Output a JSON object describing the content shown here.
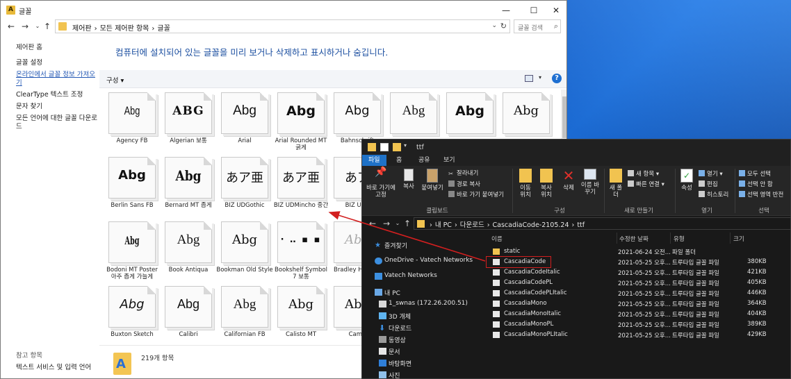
{
  "font_window": {
    "title": "글꼴",
    "breadcrumbs": [
      "제어판",
      "›",
      "모든 제어판 항목",
      "›",
      "글꼴"
    ],
    "search_placeholder": "글꼴 검색",
    "sidebar": {
      "home": "제어판 홈",
      "links": [
        "글꼴 설정",
        "온라인에서 글꼴 정보 가져오기",
        "ClearType 텍스트 조정",
        "문자 찾기",
        "모든 언어에 대한 글꼴 다운로드"
      ],
      "see_also_title": "참고 항목",
      "see_also_item": "텍스트 서비스 및 입력 언어"
    },
    "heading": "컴퓨터에 설치되어 있는 글꼴을 미리 보거나 삭제하고 표시하거나 숨깁니다.",
    "organize": "구성 ▾",
    "fonts": [
      {
        "sample": "Abg",
        "name": "Agency FB"
      },
      {
        "sample": "ABG",
        "name": "Algerian 보통"
      },
      {
        "sample": "Abg",
        "name": "Arial"
      },
      {
        "sample": "Abg",
        "name": "Arial Rounded MT 굵게"
      },
      {
        "sample": "Abg",
        "name": "Bahnschrift"
      },
      {
        "sample": "Abg",
        "name": ""
      },
      {
        "sample": "Abg",
        "name": ""
      },
      {
        "sample": "Abg",
        "name": ""
      },
      {
        "sample": "Abg",
        "name": "Berlin Sans FB"
      },
      {
        "sample": "Abg",
        "name": "Bernard MT 좁게"
      },
      {
        "sample": "あア亜",
        "name": "BIZ UDGothic"
      },
      {
        "sample": "あア亜",
        "name": "BIZ UDMincho 중간"
      },
      {
        "sample": "あア",
        "name": "BIZ UDP"
      },
      {
        "sample": "Abg",
        "name": "Bodoni MT Poster 아주 좁게 가늘게"
      },
      {
        "sample": "Abg",
        "name": "Book Antiqua"
      },
      {
        "sample": "Abg",
        "name": "Bookman Old Style"
      },
      {
        "sample": "· ‥ ▪ ▪",
        "name": "Bookshelf Symbol 7 보통"
      },
      {
        "sample": "Abg",
        "name": "Bradley H ITC 보"
      },
      {
        "sample": "Abg",
        "name": "Buxton Sketch"
      },
      {
        "sample": "Abg",
        "name": "Calibri"
      },
      {
        "sample": "Abg",
        "name": "Californian FB"
      },
      {
        "sample": "Abg",
        "name": "Calisto MT"
      },
      {
        "sample": "Abg",
        "name": "Camb"
      }
    ],
    "status_count": "219개 항목"
  },
  "explorer": {
    "title": "ttf",
    "tabs": [
      "파일",
      "홈",
      "공유",
      "보기"
    ],
    "ribbon": {
      "pin": "바로 가기에 고정",
      "copy": "복사",
      "paste": "붙여넣기",
      "cut": "잘라내기",
      "copy_path": "경로 복사",
      "paste_shortcut": "바로 가기 붙여넣기",
      "move_to": "이동 위치",
      "copy_to": "복사 위치",
      "delete": "삭제",
      "rename": "이름 바꾸기",
      "new_folder": "새 폴더",
      "new_item": "새 항목 ▾",
      "easy_access": "빠른 연결 ▾",
      "properties": "속성",
      "open": "열기 ▾",
      "edit": "편집",
      "history": "히스토리",
      "select_all": "모두 선택",
      "select_none": "선택 안 함",
      "invert_selection": "선택 영역 반전",
      "group_clipboard": "클립보드",
      "group_organize": "구성",
      "group_new": "새로 만들기",
      "group_open": "열기",
      "group_select": "선택"
    },
    "breadcrumbs": [
      "내 PC",
      "›",
      "다운로드",
      "›",
      "CascadiaCode-2105.24",
      "›",
      "ttf"
    ],
    "nav": [
      "즐겨찾기",
      "OneDrive - Vatech Networks",
      "Vatech Networks",
      "내 PC",
      "1_swnas (172.26.200.51)",
      "3D 개체",
      "다운로드",
      "동영상",
      "문서",
      "바탕화면",
      "사진"
    ],
    "columns": [
      "이름",
      "수정한 날짜",
      "유형",
      "크기"
    ],
    "files": [
      {
        "name": "static",
        "date": "2021-06-24 오전...",
        "type": "파일 폴더",
        "size": ""
      },
      {
        "name": "CascadiaCode",
        "date": "2021-05-25 오후...",
        "type": "트루타입 글꼴 파일",
        "size": "380KB"
      },
      {
        "name": "CascadiaCodeItalic",
        "date": "2021-05-25 오후...",
        "type": "트루타입 글꼴 파일",
        "size": "421KB"
      },
      {
        "name": "CascadiaCodePL",
        "date": "2021-05-25 오후...",
        "type": "트루타입 글꼴 파일",
        "size": "405KB"
      },
      {
        "name": "CascadiaCodePLItalic",
        "date": "2021-05-25 오후...",
        "type": "트루타입 글꼴 파일",
        "size": "446KB"
      },
      {
        "name": "CascadiaMono",
        "date": "2021-05-25 오후...",
        "type": "트루타입 글꼴 파일",
        "size": "364KB"
      },
      {
        "name": "CascadiaMonoItalic",
        "date": "2021-05-25 오후...",
        "type": "트루타입 글꼴 파일",
        "size": "404KB"
      },
      {
        "name": "CascadiaMonoPL",
        "date": "2021-05-25 오후...",
        "type": "트루타입 글꼴 파일",
        "size": "389KB"
      },
      {
        "name": "CascadiaMonoPLItalic",
        "date": "2021-05-25 오후...",
        "type": "트루타입 글꼴 파일",
        "size": "429KB"
      }
    ]
  },
  "colors": {
    "accent": "#1f72c7",
    "annotation": "#d21f1f",
    "link": "#2156b3"
  }
}
